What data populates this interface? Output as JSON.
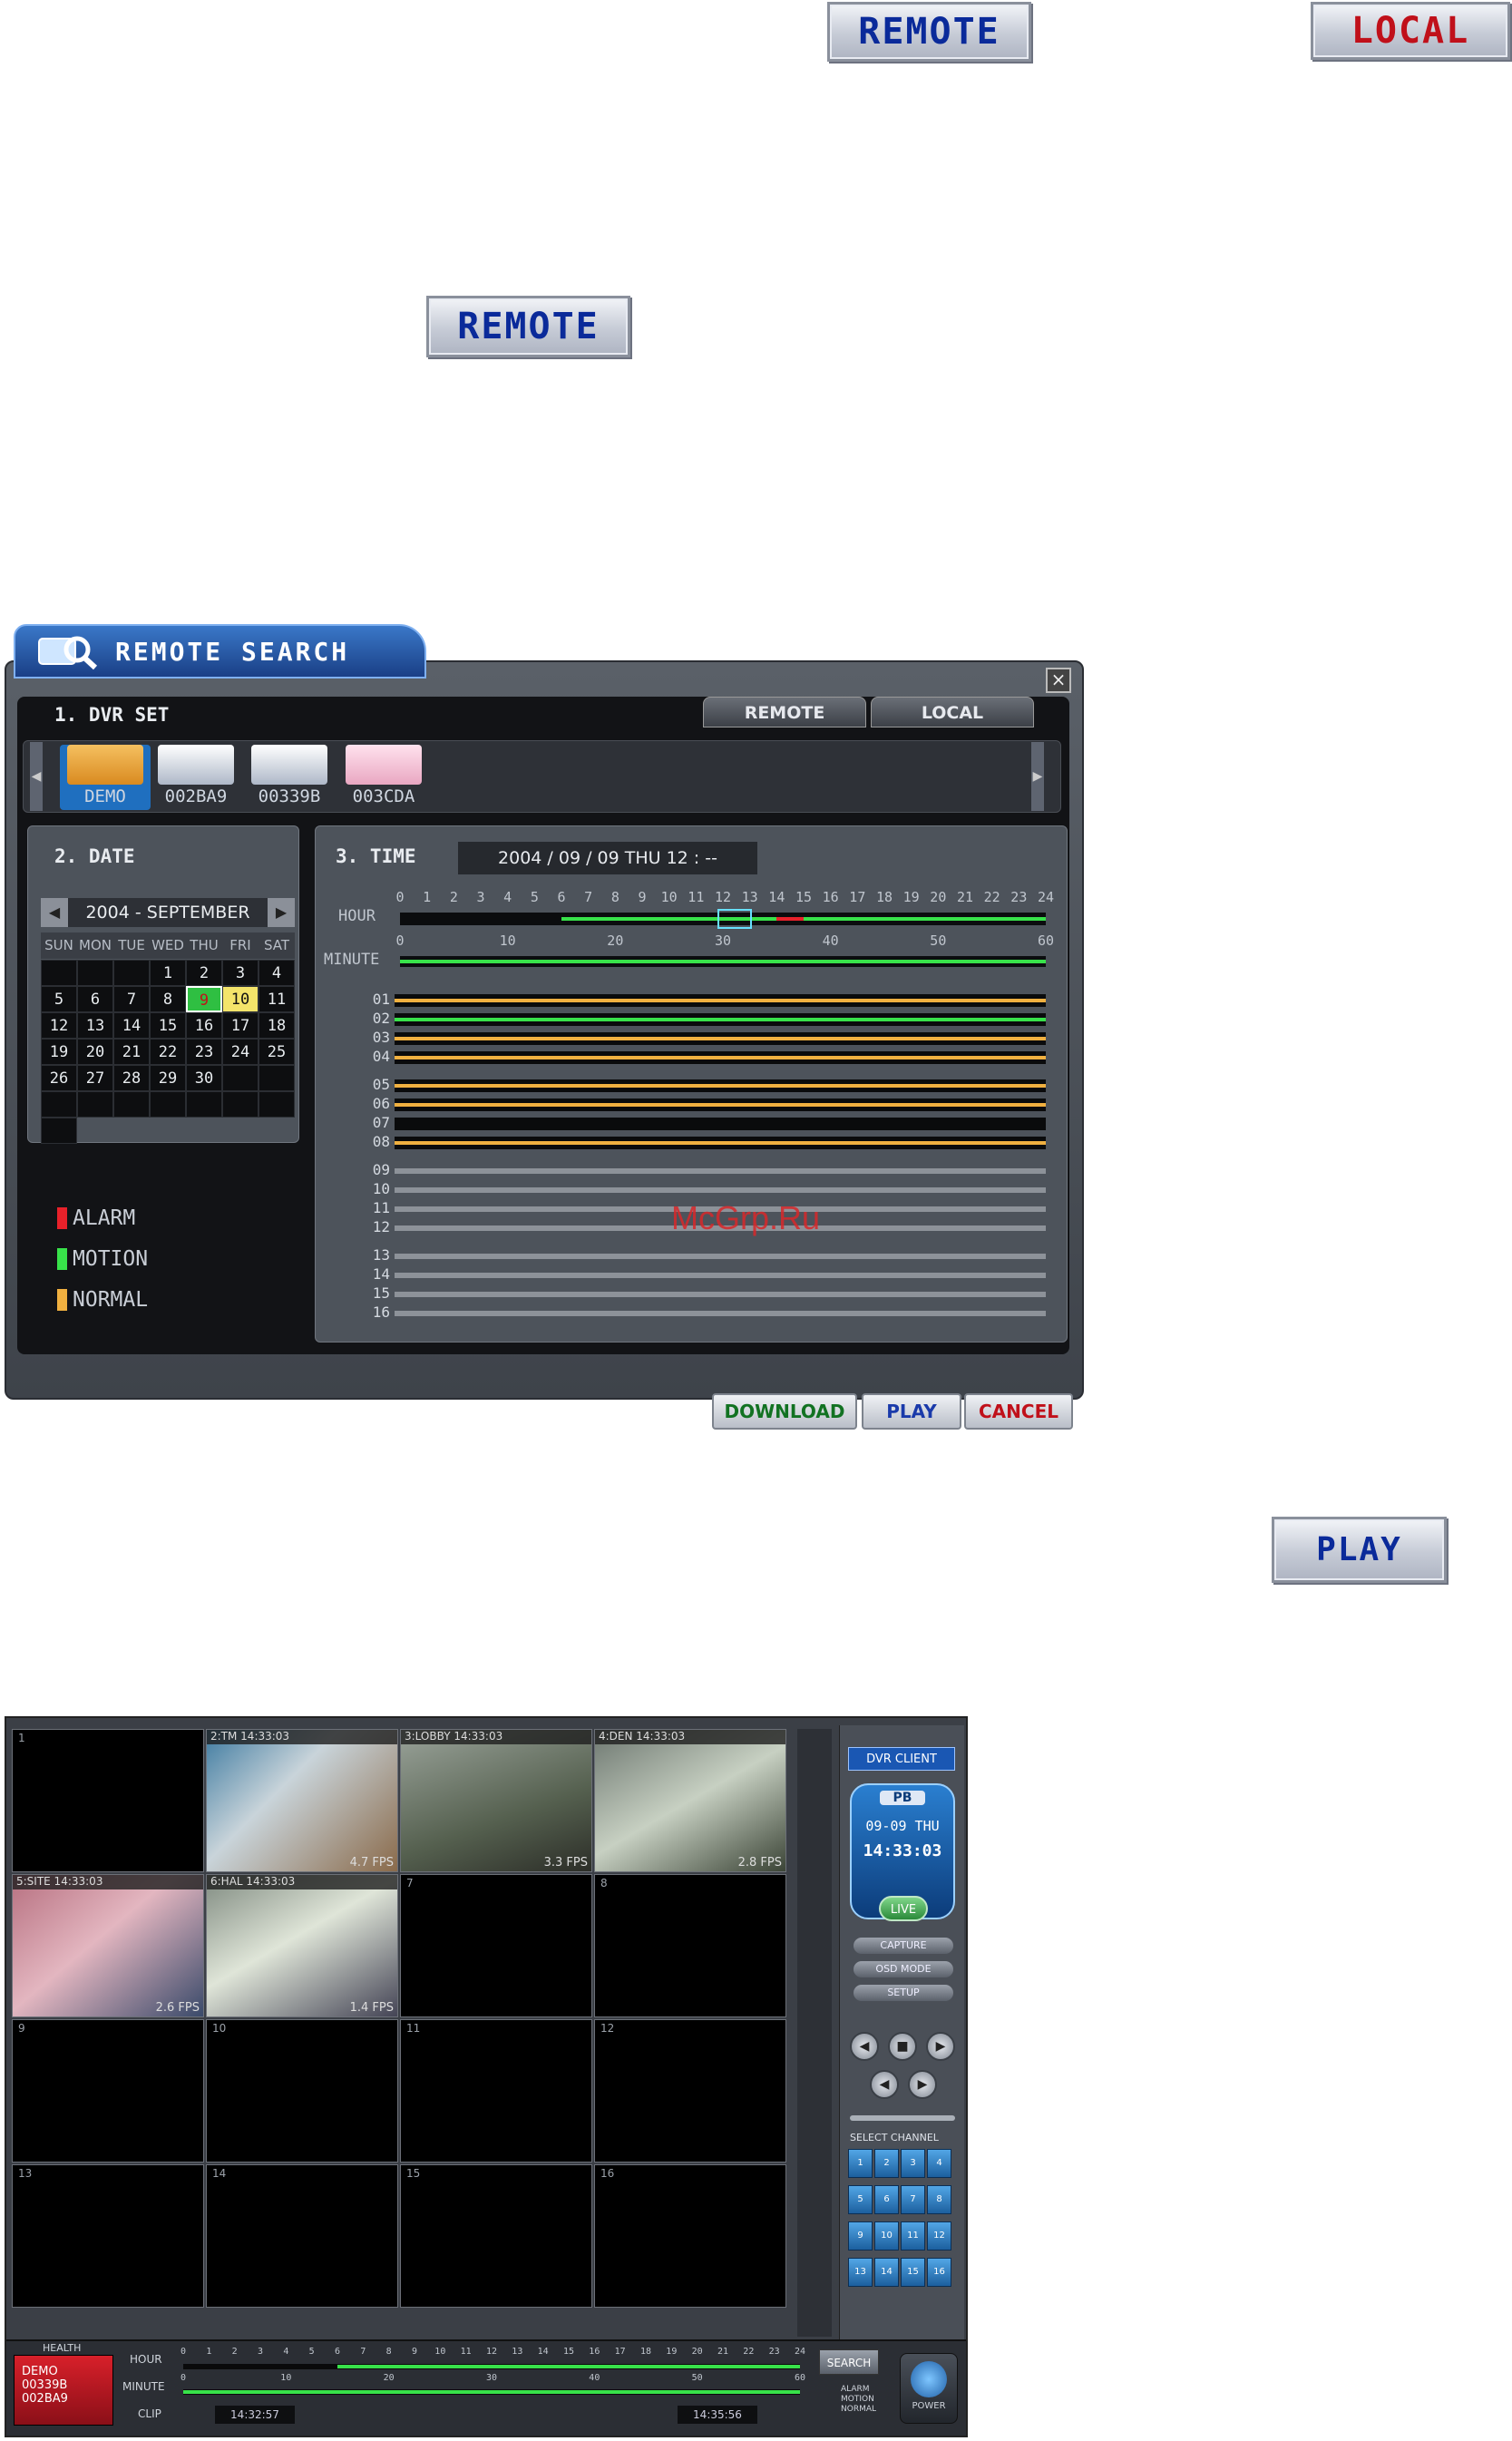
{
  "buttons": {
    "remote_top": "REMOTE",
    "local_top": "LOCAL",
    "remote_mid": "REMOTE",
    "play": "PLAY"
  },
  "remote_search": {
    "title": "REMOTE SEARCH",
    "close": "×",
    "section1": "1. DVR SET",
    "tabs": [
      "REMOTE",
      "LOCAL"
    ],
    "dvrs": [
      "DEMO",
      "002BA9",
      "00339B",
      "003CDA"
    ],
    "section2": "2. DATE",
    "month_label": "2004 - SEPTEMBER",
    "weekdays": [
      "SUN",
      "MON",
      "TUE",
      "WED",
      "THU",
      "FRI",
      "SAT"
    ],
    "days": [
      "",
      "",
      "",
      "1",
      "2",
      "3",
      "4",
      "5",
      "6",
      "7",
      "8",
      "9",
      "10",
      "11",
      "12",
      "13",
      "14",
      "15",
      "16",
      "17",
      "18",
      "19",
      "20",
      "21",
      "22",
      "23",
      "24",
      "25",
      "26",
      "27",
      "28",
      "29",
      "30",
      "",
      "",
      "",
      "",
      "",
      "",
      "",
      "",
      "",
      ""
    ],
    "selected_day": "9",
    "today_day": "10",
    "legend": [
      "ALARM",
      "MOTION",
      "NORMAL"
    ],
    "legend_colors": [
      "#e8212a",
      "#38e24a",
      "#f0b040"
    ],
    "section3": "3. TIME",
    "time_readout": "2004 / 09 / 09 THU 12 : --",
    "hour_label": "HOUR",
    "minute_label": "MINUTE",
    "hour_ticks": [
      "0",
      "1",
      "2",
      "3",
      "4",
      "5",
      "6",
      "7",
      "8",
      "9",
      "10",
      "11",
      "12",
      "13",
      "14",
      "15",
      "16",
      "17",
      "18",
      "19",
      "20",
      "21",
      "22",
      "23",
      "24"
    ],
    "minute_ticks": [
      "0",
      "10",
      "20",
      "30",
      "40",
      "50",
      "60"
    ],
    "channels": [
      "01",
      "02",
      "03",
      "04",
      "05",
      "06",
      "07",
      "08",
      "09",
      "10",
      "11",
      "12",
      "13",
      "14",
      "15",
      "16"
    ],
    "channel_rec": [
      "normal",
      "motion",
      "normal",
      "normal",
      "normal",
      "normal",
      "none",
      "normal",
      "empty",
      "empty",
      "empty",
      "empty",
      "empty",
      "empty",
      "empty",
      "empty"
    ],
    "footer": [
      "DOWNLOAD",
      "PLAY",
      "CANCEL"
    ]
  },
  "watermark": "McGrp.Ru",
  "dvr_client": {
    "brand": "DVR CLIENT",
    "mode": "PB",
    "date": "09-09 THU",
    "time": "14:33:03",
    "live": "LIVE",
    "side_buttons": [
      "CAPTURE",
      "OSD MODE",
      "SETUP"
    ],
    "select_channel": "SELECT CHANNEL",
    "health": "HEALTH",
    "search": "SEARCH",
    "power": "POWER",
    "hour_label": "HOUR",
    "minute_label": "MINUTE",
    "clip_label": "CLIP",
    "clip_start": "14:32:57",
    "clip_end": "14:35:56",
    "cells": [
      {
        "n": "1",
        "cap": "",
        "fps": ""
      },
      {
        "n": "2",
        "cap": "2:TM          14:33:03",
        "fps": "4.7 FPS"
      },
      {
        "n": "3",
        "cap": "3:LOBBY       14:33:03",
        "fps": "3.3 FPS"
      },
      {
        "n": "4",
        "cap": "4:DEN         14:33:03",
        "fps": "2.8 FPS"
      },
      {
        "n": "5",
        "cap": "5:SITE        14:33:03",
        "fps": "2.6 FPS"
      },
      {
        "n": "6",
        "cap": "6:HAL         14:33:03",
        "fps": "1.4 FPS"
      },
      {
        "n": "7",
        "cap": "",
        "fps": ""
      },
      {
        "n": "8",
        "cap": "",
        "fps": ""
      },
      {
        "n": "9",
        "cap": "",
        "fps": ""
      },
      {
        "n": "10",
        "cap": "",
        "fps": ""
      },
      {
        "n": "11",
        "cap": "",
        "fps": ""
      },
      {
        "n": "12",
        "cap": "",
        "fps": ""
      },
      {
        "n": "13",
        "cap": "",
        "fps": ""
      },
      {
        "n": "14",
        "cap": "",
        "fps": ""
      },
      {
        "n": "15",
        "cap": "",
        "fps": ""
      },
      {
        "n": "16",
        "cap": "",
        "fps": ""
      }
    ],
    "health_items": [
      "DEMO",
      "00339B",
      "002BA9"
    ],
    "hour_ticks": [
      "0",
      "1",
      "2",
      "3",
      "4",
      "5",
      "6",
      "7",
      "8",
      "9",
      "10",
      "11",
      "12",
      "13",
      "14",
      "15",
      "16",
      "17",
      "18",
      "19",
      "20",
      "21",
      "22",
      "23",
      "24"
    ],
    "minute_ticks": [
      "0",
      "10",
      "20",
      "30",
      "40",
      "50",
      "60"
    ],
    "legend": [
      "ALARM",
      "MOTION",
      "NORMAL"
    ]
  }
}
